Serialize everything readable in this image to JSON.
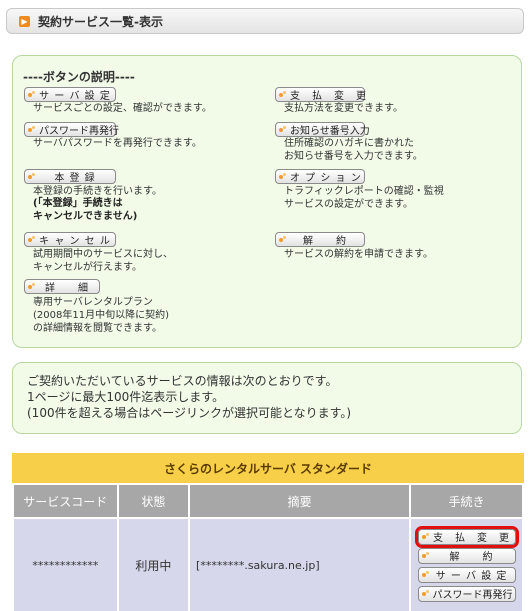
{
  "title": "契約サービス一覧-表示",
  "guide": {
    "heading": "----ボタンの説明----",
    "items": [
      {
        "button": "サ ー バ 設 定",
        "desc": [
          "サービスごとの設定、確認ができます。"
        ]
      },
      {
        "button": "パスワード再発行",
        "desc": [
          "サーバパスワードを再発行できます。"
        ]
      },
      {
        "button": "本 登 録",
        "desc": [
          "本登録の手続きを行います。"
        ],
        "bold": [
          "(「本登録」手続きは",
          "キャンセルできません)"
        ]
      },
      {
        "button": "キ ャ ン セ ル",
        "desc": [
          "試用期間中のサービスに対し、",
          "キャンセルが行えます。"
        ]
      },
      {
        "button": "詳　　細",
        "desc": [
          "専用サーバレンタルプラン",
          "(2008年11月中旬以降に契約)",
          "の詳細情報を閲覧できます。"
        ]
      },
      {
        "button": "支　払　変　更",
        "desc": [
          "支払方法を変更できます。"
        ]
      },
      {
        "button": "お知らせ番号入力",
        "desc": [
          "住所確認のハガキに書かれた",
          "お知らせ番号を入力できます。"
        ]
      },
      {
        "button": "オ プ シ ョ ン",
        "desc": [
          "トラフィックレポートの確認・監視",
          "サービスの設定ができます。"
        ]
      },
      {
        "button": "解　　約",
        "desc": [
          "サービスの解約を申請できます。"
        ]
      }
    ]
  },
  "info": {
    "lines": [
      "ご契約いただいているサービスの情報は次のとおりです。",
      "1ページに最大100件迄表示します。",
      "(100件を超える場合はページリンクが選択可能となります。)"
    ]
  },
  "plan": {
    "name": "さくらのレンタルサーバ スタンダード",
    "columns": [
      "サービスコード",
      "状態",
      "摘要",
      "手続き"
    ],
    "row": {
      "code": "************",
      "status": "利用中",
      "summary": "[********.sakura.ne.jp]",
      "actions": [
        "支　払　変　更",
        "解　　約",
        "サ ー バ 設 定",
        "パスワード再発行"
      ]
    }
  },
  "colors": {
    "accent": "#f08a1c",
    "panel_bg": "#f1fbe8",
    "panel_border": "#b8d8a0",
    "plan_header": "#f7cf48",
    "table_header": "#a7a7a7",
    "table_cell": "#d7d7eb",
    "highlight": "#e01010"
  }
}
